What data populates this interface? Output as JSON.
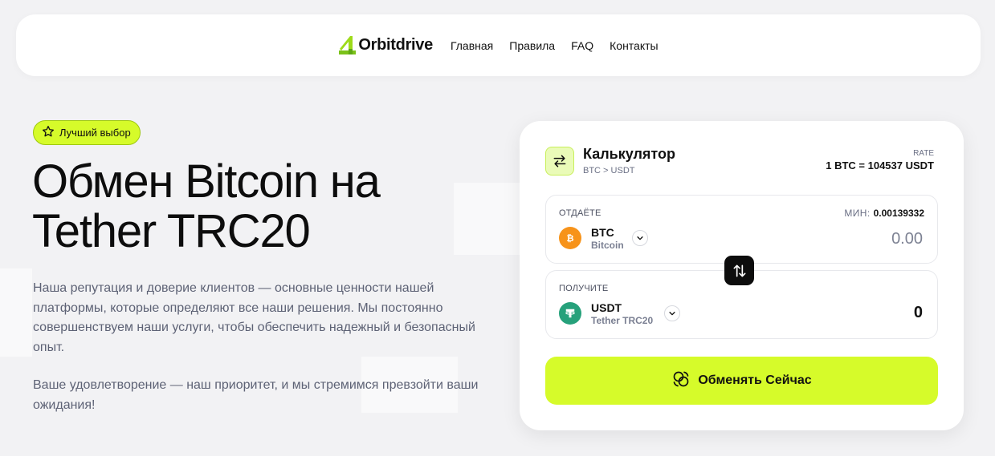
{
  "header": {
    "logo_text": "Orbitdrive",
    "nav": [
      "Главная",
      "Правила",
      "FAQ",
      "Контакты"
    ]
  },
  "hero": {
    "badge": "Лучший выбор",
    "title_line1": "Обмен Bitcoin на",
    "title_line2": "Tether TRC20",
    "paragraph1": "Наша репутация и доверие клиентов — основные ценности нашей платформы, которые определяют все наши решения. Мы постоянно совершенствуем наши услуги, чтобы обеспечить надежный и безопасный опыт.",
    "paragraph2": "Ваше удовлетворение — наш приоритет, и мы стремимся превзойти ваши ожидания!"
  },
  "calculator": {
    "title": "Калькулятор",
    "pair": "BTC > USDT",
    "rate_label": "RATE",
    "rate_value": "1 BTC = 104537 USDT",
    "give": {
      "label": "ОТДАЁТЕ",
      "min_label": "МИН:",
      "min_value": "0.00139332",
      "coin_code": "BTC",
      "coin_name": "Bitcoin",
      "coin_icon": "bitcoin-icon",
      "amount": "0.00"
    },
    "get": {
      "label": "ПОЛУЧИТЕ",
      "coin_code": "USDT",
      "coin_name": "Tether TRC20",
      "coin_icon": "tether-icon",
      "amount": "0"
    },
    "exchange_button": "Обменять Сейчас"
  },
  "colors": {
    "accent": "#d6fb2a",
    "background": "#f2f2f4",
    "bitcoin": "#f7931a",
    "tether": "#26a17b"
  }
}
